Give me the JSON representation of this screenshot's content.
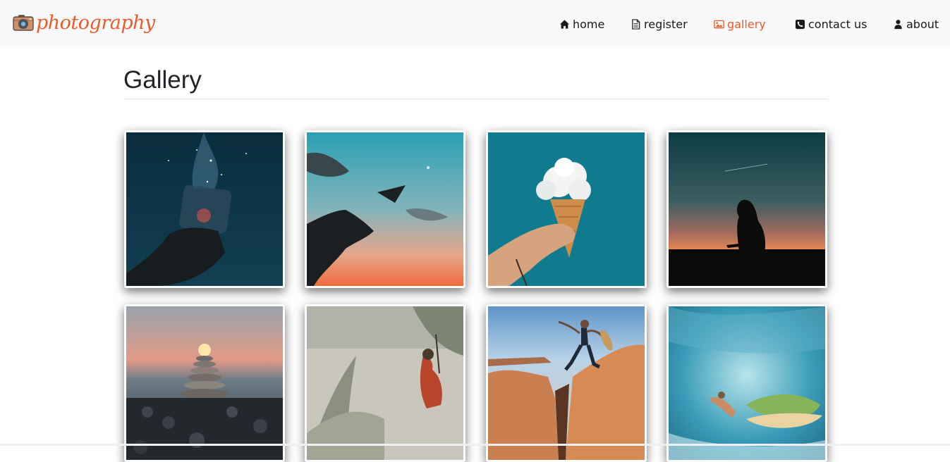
{
  "brand": {
    "name": "photography",
    "icon": "camera-icon",
    "color": "#f05a28"
  },
  "nav": {
    "items": [
      {
        "id": "home",
        "label": "home",
        "icon": "home-icon",
        "active": false
      },
      {
        "id": "register",
        "label": "register",
        "icon": "document-icon",
        "active": false
      },
      {
        "id": "gallery",
        "label": "gallery",
        "icon": "image-icon",
        "active": true
      },
      {
        "id": "contact",
        "label": "contact us",
        "icon": "phone-icon",
        "active": false
      },
      {
        "id": "about",
        "label": "about",
        "icon": "user-icon",
        "active": false
      }
    ]
  },
  "page": {
    "title": "Gallery"
  },
  "gallery": {
    "photos": [
      {
        "id": "galaxy-jar"
      },
      {
        "id": "paper-plane"
      },
      {
        "id": "cloud-cone"
      },
      {
        "id": "silhouette-sunset"
      },
      {
        "id": "stone-stack"
      },
      {
        "id": "dune-grass"
      },
      {
        "id": "canyon-jump"
      },
      {
        "id": "wave-surfer"
      }
    ]
  },
  "colors": {
    "accent": "#f05a28",
    "navbar_bg": "#f8f9fa",
    "text": "#1a1a1a"
  }
}
